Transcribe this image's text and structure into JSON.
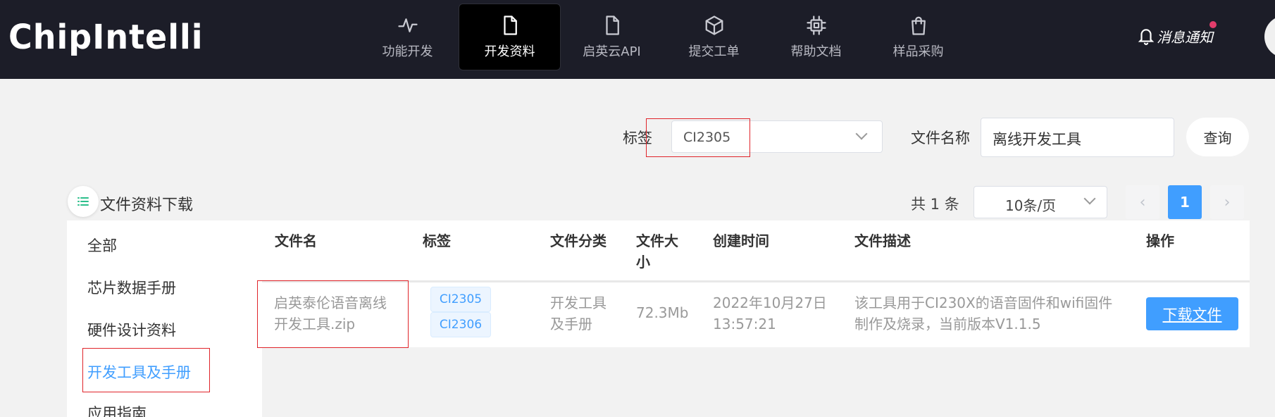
{
  "header": {
    "logo": "ChipIntelli",
    "nav": [
      {
        "label": "功能开发",
        "icon": "activity-icon"
      },
      {
        "label": "开发资料",
        "icon": "file-icon",
        "active": true
      },
      {
        "label": "启英云API",
        "icon": "document-icon"
      },
      {
        "label": "提交工单",
        "icon": "box-icon"
      },
      {
        "label": "帮助文档",
        "icon": "chip-icon"
      },
      {
        "label": "样品采购",
        "icon": "shopping-bag-icon"
      }
    ],
    "notice_label": "消息通知"
  },
  "search": {
    "tag_label": "标签",
    "tag_value": "CI2305",
    "filename_label": "文件名称",
    "filename_value": "离线开发工具",
    "query_button": "查询"
  },
  "section": {
    "title": "文件资料下载"
  },
  "pagination": {
    "total_text": "共 1 条",
    "page_size": "10条/页",
    "prev": "‹",
    "current_page": "1",
    "next": "›"
  },
  "sidebar": {
    "items": [
      {
        "label": "全部"
      },
      {
        "label": "芯片数据手册"
      },
      {
        "label": "硬件设计资料"
      },
      {
        "label": "开发工具及手册",
        "active": true
      },
      {
        "label": "应用指南"
      }
    ]
  },
  "table": {
    "columns": {
      "name": "文件名",
      "tag": "标签",
      "category_line1": "文件分类",
      "size_line1": "文件大",
      "size_line2": "小",
      "created": "创建时间",
      "desc": "文件描述",
      "action": "操作"
    },
    "rows": [
      {
        "name_line1": "启英泰伦语音离线",
        "name_line2": "开发工具.zip",
        "tags": [
          "CI2305",
          "CI2306"
        ],
        "category_line1": "开发工具",
        "category_line2": "及手册",
        "size": "72.3Mb",
        "created_line1": "2022年10月27日",
        "created_line2": "13:57:21",
        "desc_line1": "该工具用于CI230X的语音固件和wifi固件",
        "desc_line2": "制作及烧录，当前版本V1.1.5",
        "action_label": "下载文件"
      }
    ]
  },
  "colors": {
    "header_bg": "#1c1d28",
    "accent": "#409eff",
    "highlight_box": "#e0242a",
    "page_bg": "#f2f2f2"
  }
}
